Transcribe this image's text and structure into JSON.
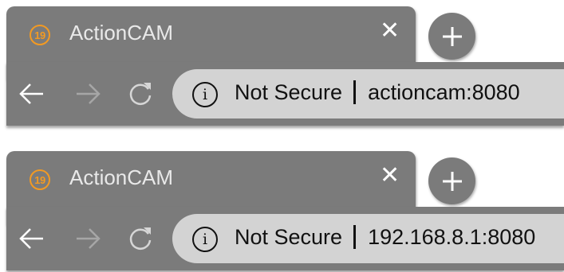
{
  "colors": {
    "chrome": "#7b7b7b",
    "address_bar": "#d3d3d3",
    "favicon_accent": "#f39a22"
  },
  "browsers": [
    {
      "tab": {
        "favicon_text": "19",
        "title": "ActionCAM",
        "close_icon": "close-icon"
      },
      "address": {
        "security_icon": "info-icon",
        "security_label": "Not Secure",
        "url": "actioncam:8080"
      }
    },
    {
      "tab": {
        "favicon_text": "19",
        "title": "ActionCAM",
        "close_icon": "close-icon"
      },
      "address": {
        "security_icon": "info-icon",
        "security_label": "Not Secure",
        "url": "192.168.8.1:8080"
      }
    }
  ]
}
